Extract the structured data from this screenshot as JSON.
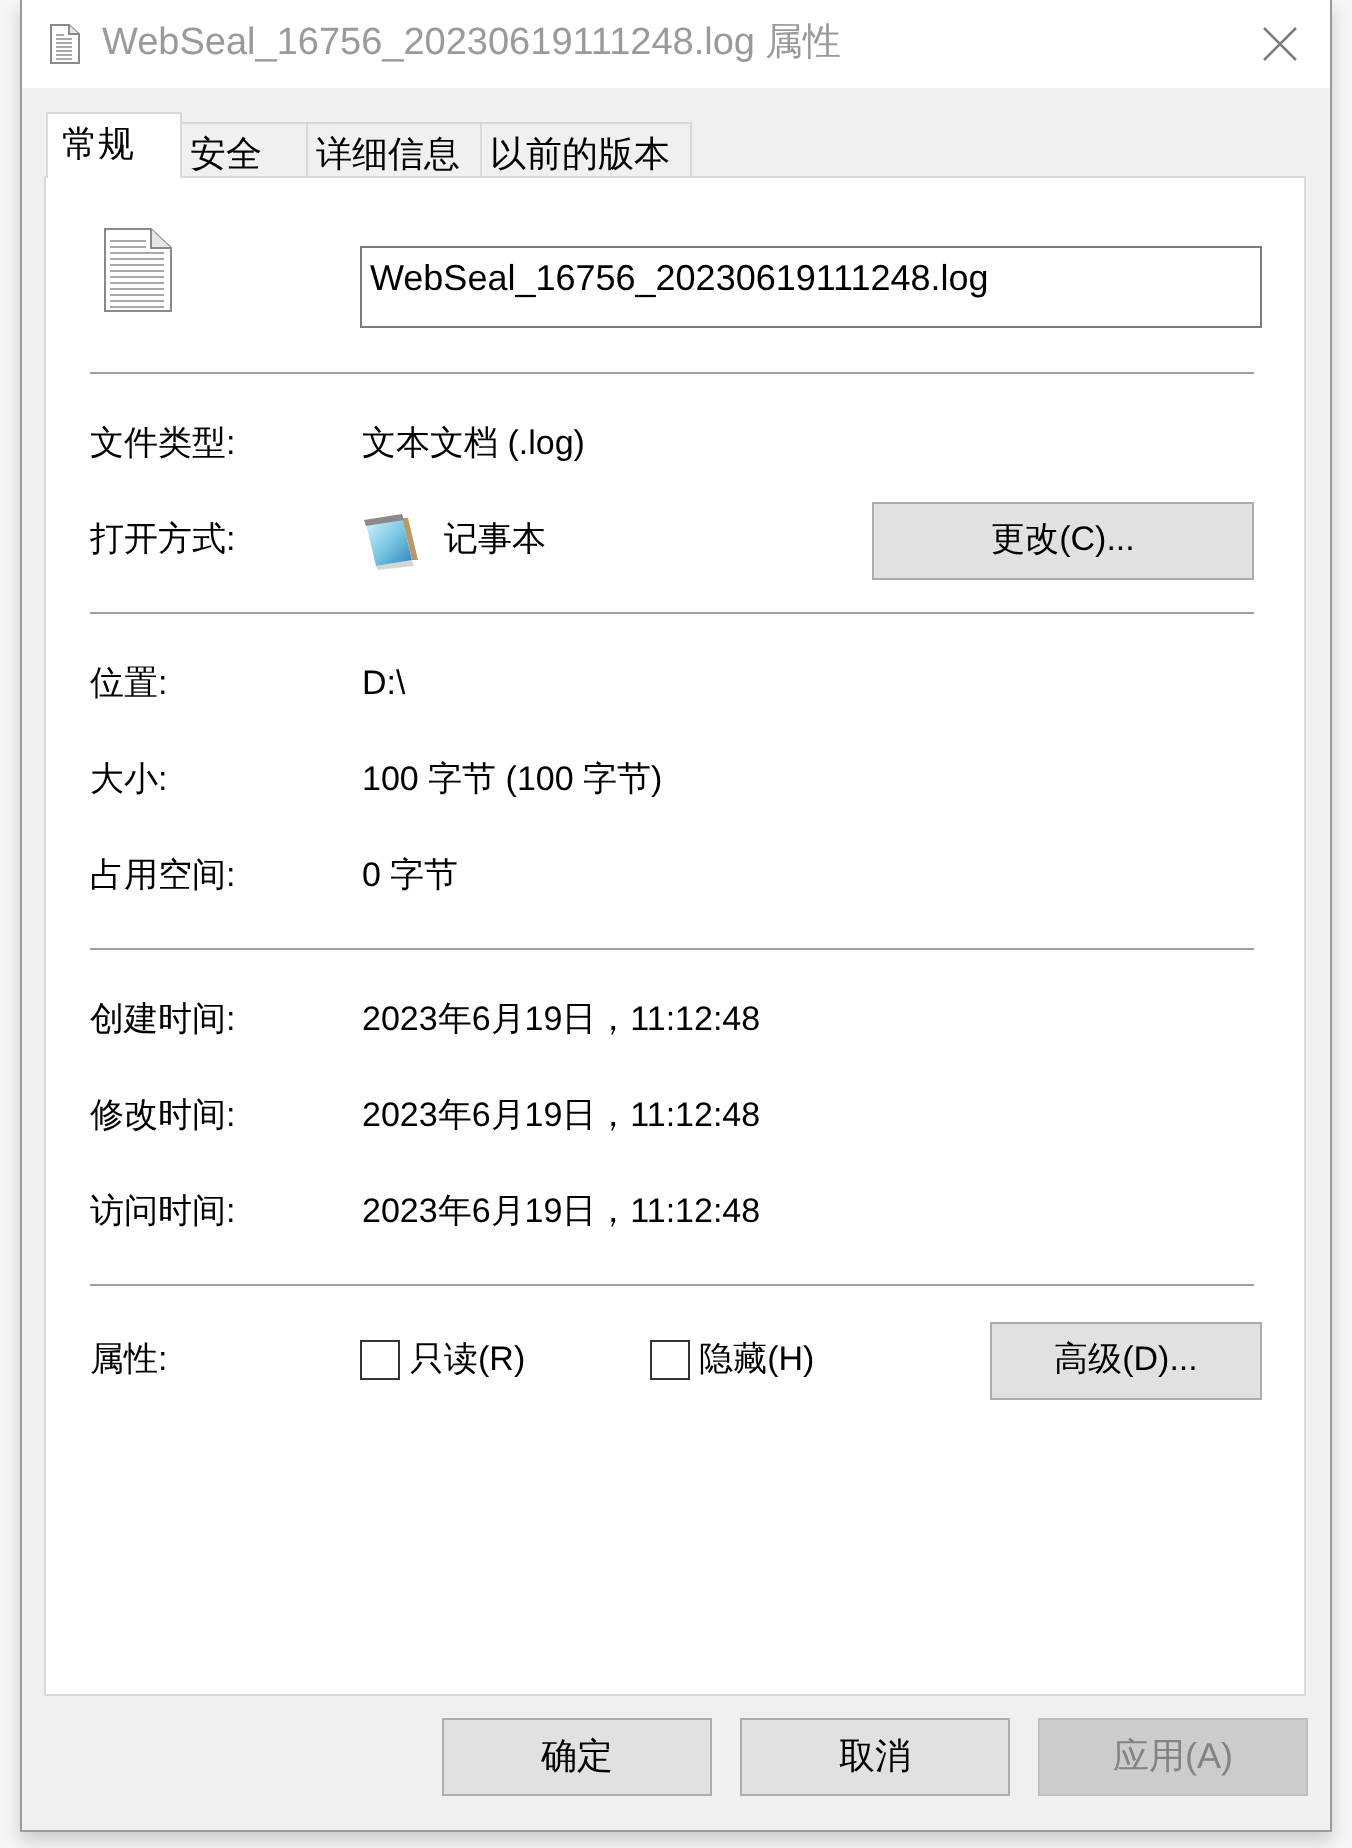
{
  "window": {
    "title": "WebSeal_16756_20230619111248.log 属性"
  },
  "tabs": [
    {
      "label": "常规",
      "selected": true
    },
    {
      "label": "安全",
      "selected": false
    },
    {
      "label": "详细信息",
      "selected": false
    },
    {
      "label": "以前的版本",
      "selected": false
    }
  ],
  "file_name": {
    "value": "WebSeal_16756_20230619111248.log"
  },
  "sections": [
    {
      "rows": [
        {
          "kind": "text",
          "label": "文件类型:",
          "value": "文本文档 (.log)"
        },
        {
          "kind": "app",
          "label": "打开方式:",
          "value": "记事本",
          "button": {
            "label": "更改(C)..."
          }
        }
      ]
    },
    {
      "rows": [
        {
          "kind": "text",
          "label": "位置:",
          "value": "D:\\"
        },
        {
          "kind": "text",
          "label": "大小:",
          "value": "100 字节 (100 字节)"
        },
        {
          "kind": "text",
          "label": "占用空间:",
          "value": "0 字节"
        }
      ]
    },
    {
      "rows": [
        {
          "kind": "text",
          "label": "创建时间:",
          "value": "2023年6月19日，11:12:48"
        },
        {
          "kind": "text",
          "label": "修改时间:",
          "value": "2023年6月19日，11:12:48"
        },
        {
          "kind": "text",
          "label": "访问时间:",
          "value": "2023年6月19日，11:12:48"
        }
      ]
    }
  ],
  "attributes": {
    "label": "属性:",
    "checkboxes": [
      {
        "label": "只读(R)",
        "checked": false
      },
      {
        "label": "隐藏(H)",
        "checked": false
      }
    ],
    "button": {
      "label": "高级(D)..."
    }
  },
  "buttons": [
    {
      "label": "确定",
      "disabled": false
    },
    {
      "label": "取消",
      "disabled": false
    },
    {
      "label": "应用(A)",
      "disabled": true
    }
  ]
}
